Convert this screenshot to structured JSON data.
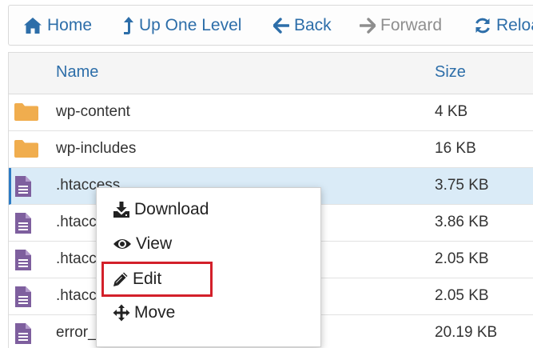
{
  "toolbar": {
    "home": "Home",
    "up_one_level": "Up One Level",
    "back": "Back",
    "forward": "Forward",
    "reload": "Reload"
  },
  "table": {
    "columns": {
      "name": "Name",
      "size": "Size"
    },
    "rows": [
      {
        "type": "folder",
        "icon": "folder-icon",
        "name": "wp-content",
        "size": "4 KB"
      },
      {
        "type": "folder",
        "icon": "folder-icon",
        "name": "wp-includes",
        "size": "16 KB"
      },
      {
        "type": "file",
        "icon": "file-icon",
        "name": ".htaccess",
        "size": "3.75 KB",
        "selected": true
      },
      {
        "type": "file",
        "icon": "file-icon",
        "name": ".htacc",
        "size": "3.86 KB"
      },
      {
        "type": "file",
        "icon": "file-icon",
        "name": ".htacc",
        "size": "2.05 KB"
      },
      {
        "type": "file",
        "icon": "file-icon",
        "name": ".htacc",
        "size": "2.05 KB"
      },
      {
        "type": "file",
        "icon": "file-icon",
        "name": "error_",
        "size": "20.19 KB"
      }
    ]
  },
  "context_menu": {
    "items": [
      {
        "label": "Download",
        "icon": "download-icon"
      },
      {
        "label": "View",
        "icon": "eye-icon"
      },
      {
        "label": "Edit",
        "icon": "pencil-icon",
        "highlighted": true
      },
      {
        "label": "Move",
        "icon": "move-icon"
      }
    ]
  },
  "colors": {
    "link_blue": "#2d6ea9",
    "folder": "#f0ad4e",
    "file": "#7e5f9e",
    "selected_row": "#daebf7",
    "highlight_box": "#d3202a"
  }
}
